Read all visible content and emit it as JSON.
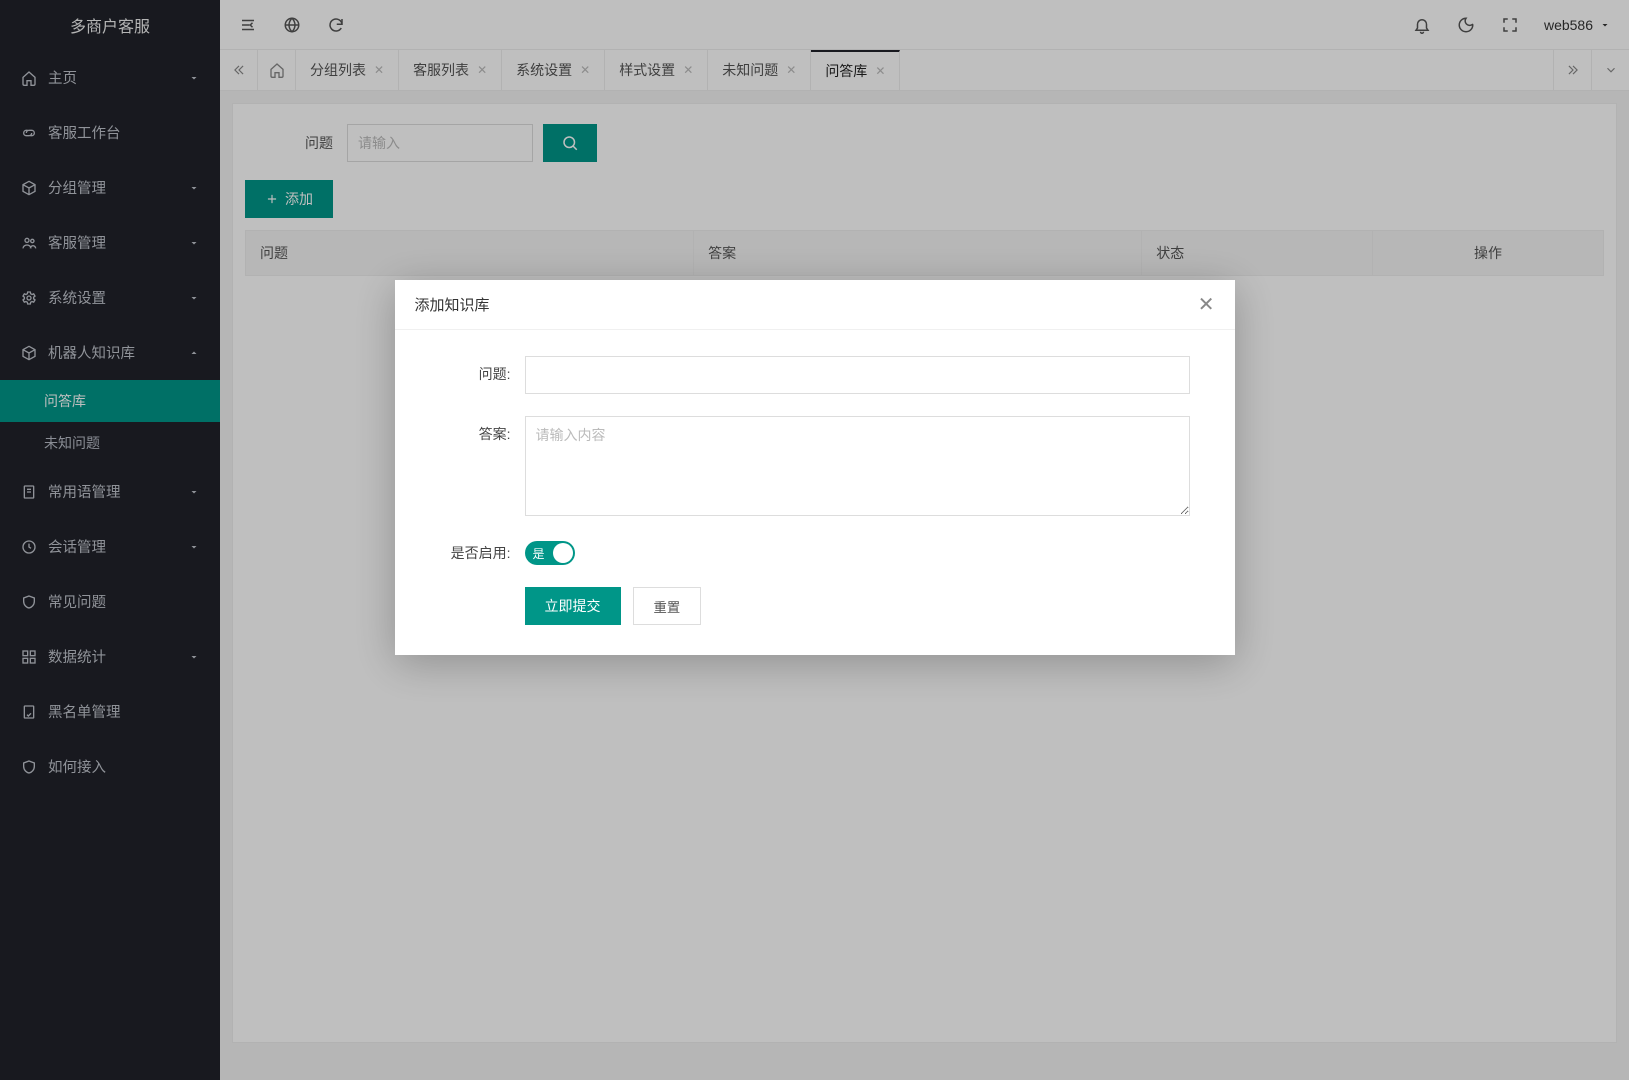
{
  "app": {
    "title": "多商户客服"
  },
  "sidebar": {
    "items": [
      {
        "label": "主页",
        "icon": "home",
        "expandable": true,
        "expanded": false
      },
      {
        "label": "客服工作台",
        "icon": "link",
        "expandable": false
      },
      {
        "label": "分组管理",
        "icon": "cube",
        "expandable": true,
        "expanded": false
      },
      {
        "label": "客服管理",
        "icon": "team",
        "expandable": true,
        "expanded": false
      },
      {
        "label": "系统设置",
        "icon": "gear",
        "expandable": true,
        "expanded": false
      },
      {
        "label": "机器人知识库",
        "icon": "cube",
        "expandable": true,
        "expanded": true,
        "children": [
          {
            "label": "问答库",
            "active": true
          },
          {
            "label": "未知问题",
            "active": false
          }
        ]
      },
      {
        "label": "常用语管理",
        "icon": "note",
        "expandable": true,
        "expanded": false
      },
      {
        "label": "会话管理",
        "icon": "clock",
        "expandable": true,
        "expanded": false
      },
      {
        "label": "常见问题",
        "icon": "shield",
        "expandable": false
      },
      {
        "label": "数据统计",
        "icon": "grid",
        "expandable": true,
        "expanded": false
      },
      {
        "label": "黑名单管理",
        "icon": "doc",
        "expandable": false
      },
      {
        "label": "如何接入",
        "icon": "shield",
        "expandable": false
      }
    ]
  },
  "topbar": {
    "user": "web586"
  },
  "tabs": {
    "items": [
      {
        "label": "分组列表",
        "closable": true,
        "active": false
      },
      {
        "label": "客服列表",
        "closable": true,
        "active": false
      },
      {
        "label": "系统设置",
        "closable": true,
        "active": false
      },
      {
        "label": "样式设置",
        "closable": true,
        "active": false
      },
      {
        "label": "未知问题",
        "closable": true,
        "active": false
      },
      {
        "label": "问答库",
        "closable": true,
        "active": true
      }
    ]
  },
  "search": {
    "label": "问题",
    "placeholder": "请输入"
  },
  "buttons": {
    "add": "添加"
  },
  "table": {
    "cols": [
      "问题",
      "答案",
      "状态",
      "操作"
    ]
  },
  "modal": {
    "title": "添加知识库",
    "fields": {
      "question_label": "问题:",
      "answer_label": "答案:",
      "answer_placeholder": "请输入内容",
      "enable_label": "是否启用:",
      "enable_on_text": "是"
    },
    "actions": {
      "submit": "立即提交",
      "reset": "重置"
    }
  }
}
